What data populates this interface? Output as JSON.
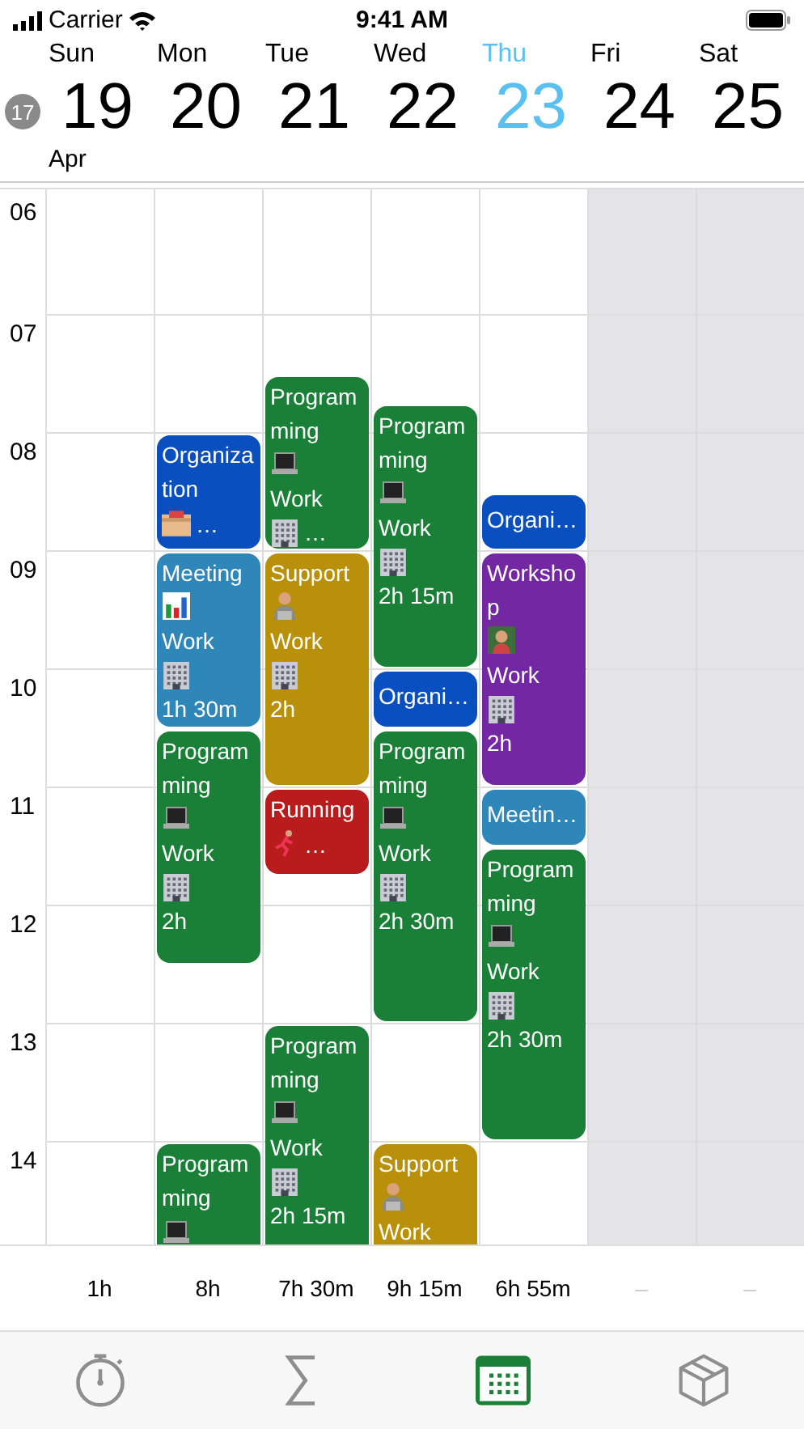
{
  "status_bar": {
    "carrier": "Carrier",
    "time": "9:41 AM"
  },
  "week_badge": "17",
  "month": "Apr",
  "hours": [
    "06",
    "07",
    "08",
    "09",
    "10",
    "11",
    "12",
    "13",
    "14"
  ],
  "days": [
    {
      "name": "Sun",
      "date": "19",
      "today": false,
      "off": false,
      "total": "1h"
    },
    {
      "name": "Mon",
      "date": "20",
      "today": false,
      "off": false,
      "total": "8h",
      "events": [
        {
          "kind": "organization",
          "color": "#0a4fbf",
          "title": "Organization",
          "more": "…"
        },
        {
          "kind": "meeting",
          "color": "#2f86b8",
          "title": "Meeting",
          "category": "Work",
          "duration": "1h 30m"
        },
        {
          "kind": "programming",
          "color": "#1a7f37",
          "title": "Programming",
          "category": "Work",
          "duration": "2h"
        },
        {
          "kind": "programming",
          "color": "#1a7f37",
          "title": "Programming"
        }
      ]
    },
    {
      "name": "Tue",
      "date": "21",
      "today": false,
      "off": false,
      "total": "7h 30m",
      "events": [
        {
          "kind": "programming",
          "color": "#1a7f37",
          "title": "Programming",
          "category": "Work",
          "more": "…"
        },
        {
          "kind": "support",
          "color": "#b8900a",
          "title": "Support",
          "category": "Work",
          "duration": "2h"
        },
        {
          "kind": "running",
          "color": "#b81c1c",
          "title": "Running",
          "more": "…"
        },
        {
          "kind": "programming",
          "color": "#1a7f37",
          "title": "Programming",
          "category": "Work",
          "duration": "2h 15m"
        }
      ]
    },
    {
      "name": "Wed",
      "date": "22",
      "today": false,
      "off": false,
      "total": "9h 15m",
      "events": [
        {
          "kind": "programming",
          "color": "#1a7f37",
          "title": "Programming",
          "category": "Work",
          "duration": "2h 15m"
        },
        {
          "color": "#0a4fbf",
          "title": "Organi…"
        },
        {
          "kind": "programming",
          "color": "#1a7f37",
          "title": "Programming",
          "category": "Work",
          "duration": "2h 30m"
        },
        {
          "kind": "support",
          "color": "#b8900a",
          "title": "Support",
          "category": "Work"
        }
      ]
    },
    {
      "name": "Thu",
      "date": "23",
      "today": true,
      "off": false,
      "total": "6h 55m",
      "events": [
        {
          "color": "#0a4fbf",
          "title": "Organi…"
        },
        {
          "kind": "workshop",
          "color": "#7327a3",
          "title": "Workshop",
          "category": "Work",
          "duration": "2h"
        },
        {
          "color": "#2f86b8",
          "title": "Meetin…"
        },
        {
          "kind": "programming",
          "color": "#1a7f37",
          "title": "Programming",
          "category": "Work",
          "duration": "2h 30m"
        }
      ]
    },
    {
      "name": "Fri",
      "date": "24",
      "today": false,
      "off": true,
      "total": "–"
    },
    {
      "name": "Sat",
      "date": "25",
      "today": false,
      "off": true,
      "total": "–"
    }
  ],
  "tabs": [
    {
      "kind": "timer",
      "selected": false
    },
    {
      "kind": "sum",
      "selected": false
    },
    {
      "kind": "calendar",
      "selected": true
    },
    {
      "kind": "box",
      "selected": false
    }
  ]
}
